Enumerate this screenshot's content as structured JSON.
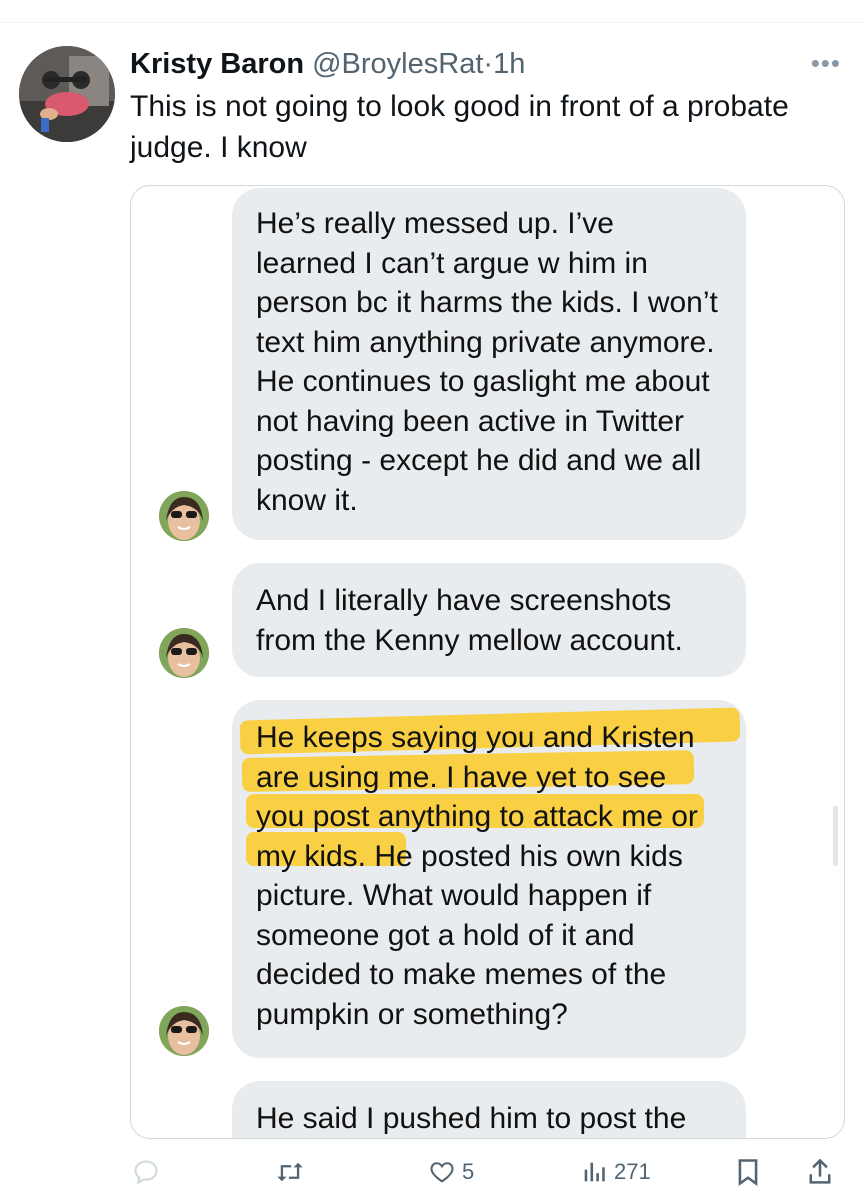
{
  "tweet": {
    "author_name": "Kristy Baron",
    "handle": "@BroylesRat",
    "separator": "·",
    "time": "1h",
    "more_label": "•••",
    "text": "This is not going to look good in front of a probate judge. I know"
  },
  "screenshot": {
    "messages": [
      {
        "text": "He’s really messed up. I’ve learned I can’t argue w him in person bc it harms the kids. I won’t text him anything private anymore. He continues to gaslight me about not having been active in Twitter posting - except he did and we all know it."
      },
      {
        "text": "And I literally have screenshots from the Kenny mellow account."
      },
      {
        "text": "He keeps saying you and Kristen are using me. I have yet to see you post anything to attack me or my kids. He posted his own kids picture. What would happen if someone got a hold of it and decided to make memes of the pumpkin or something?"
      },
      {
        "text": "He said I pushed him to post the"
      }
    ],
    "highlight_color": "#ffc400",
    "bubble_color": "#e9ecef"
  },
  "actions": {
    "reply_count": "",
    "retweet_count": "",
    "like_count": "5",
    "views_count": "271"
  },
  "colors": {
    "text": "#0f1419",
    "secondary": "#536471",
    "border": "#cfd9de"
  }
}
